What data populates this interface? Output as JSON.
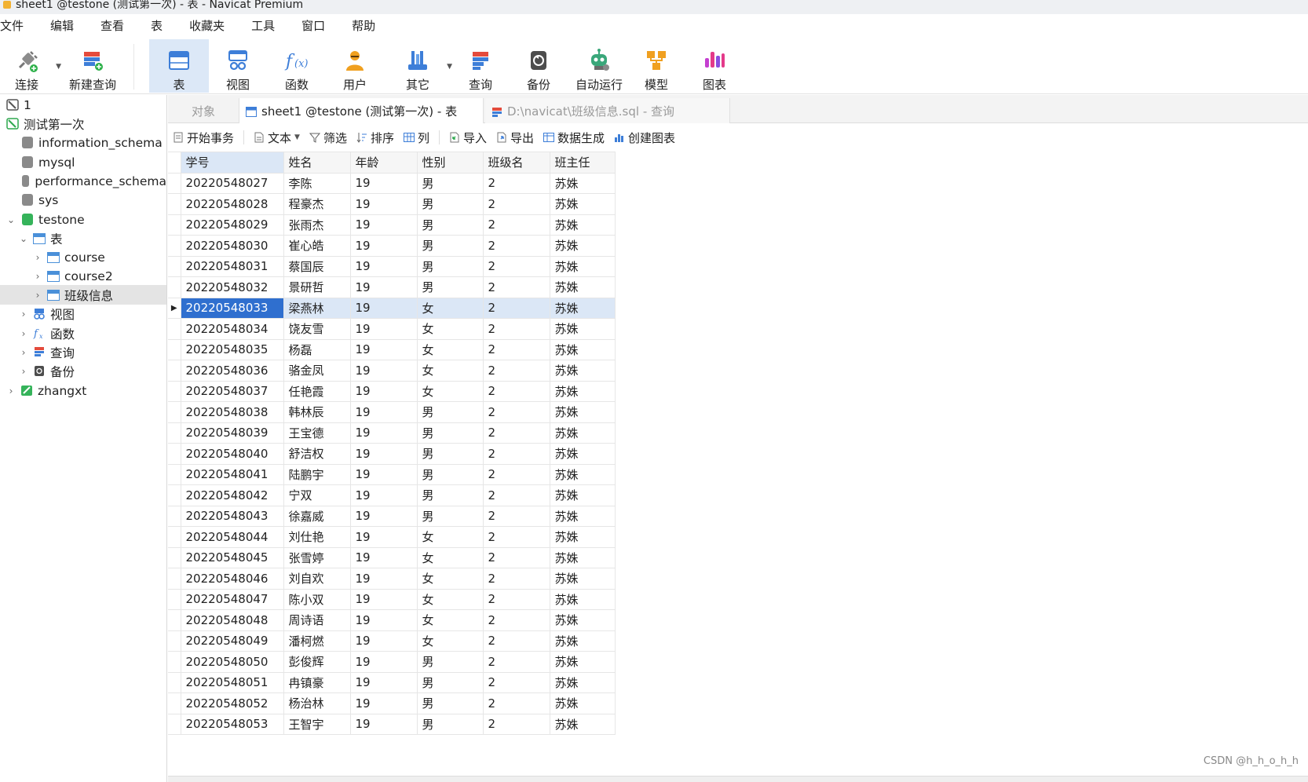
{
  "window": {
    "title": "sheet1 @testone (测试第一次) - 表 - Navicat Premium"
  },
  "menu": [
    "文件",
    "编辑",
    "查看",
    "表",
    "收藏夹",
    "工具",
    "窗口",
    "帮助"
  ],
  "toolbar": {
    "connect": "连接",
    "new_query": "新建查询",
    "table": "表",
    "view": "视图",
    "function": "函数",
    "user": "用户",
    "other": "其它",
    "query": "查询",
    "backup": "备份",
    "automation": "自动运行",
    "model": "模型",
    "chart": "图表"
  },
  "sidebar": {
    "items": [
      {
        "label": "1"
      },
      {
        "label": "测试第一次"
      },
      {
        "label": "information_schema"
      },
      {
        "label": "mysql"
      },
      {
        "label": "performance_schema"
      },
      {
        "label": "sys"
      },
      {
        "label": "testone"
      },
      {
        "label": "表"
      },
      {
        "label": "course"
      },
      {
        "label": "course2"
      },
      {
        "label": "班级信息"
      },
      {
        "label": "视图"
      },
      {
        "label": "函数"
      },
      {
        "label": "查询"
      },
      {
        "label": "备份"
      },
      {
        "label": "zhangxt"
      }
    ]
  },
  "tabs": {
    "objects": "对象",
    "active": "sheet1 @testone (测试第一次) - 表",
    "inactive": "D:\\navicat\\班级信息.sql - 查询"
  },
  "actions": {
    "begin_transaction": "开始事务",
    "text": "文本",
    "filter": "筛选",
    "sort": "排序",
    "columns": "列",
    "import": "导入",
    "export": "导出",
    "data_generation": "数据生成",
    "create_chart": "创建图表"
  },
  "grid": {
    "columns": [
      "学号",
      "姓名",
      "年龄",
      "性别",
      "班级名",
      "班主任"
    ],
    "selected_row": 6,
    "rows": [
      [
        "20220548027",
        "李陈",
        "19",
        "男",
        "2",
        "苏姝"
      ],
      [
        "20220548028",
        "程豪杰",
        "19",
        "男",
        "2",
        "苏姝"
      ],
      [
        "20220548029",
        "张雨杰",
        "19",
        "男",
        "2",
        "苏姝"
      ],
      [
        "20220548030",
        "崔心皓",
        "19",
        "男",
        "2",
        "苏姝"
      ],
      [
        "20220548031",
        "蔡国辰",
        "19",
        "男",
        "2",
        "苏姝"
      ],
      [
        "20220548032",
        "景研哲",
        "19",
        "男",
        "2",
        "苏姝"
      ],
      [
        "20220548033",
        "梁燕林",
        "19",
        "女",
        "2",
        "苏姝"
      ],
      [
        "20220548034",
        "饶友雪",
        "19",
        "女",
        "2",
        "苏姝"
      ],
      [
        "20220548035",
        "杨磊",
        "19",
        "女",
        "2",
        "苏姝"
      ],
      [
        "20220548036",
        "骆金凤",
        "19",
        "女",
        "2",
        "苏姝"
      ],
      [
        "20220548037",
        "任艳霞",
        "19",
        "女",
        "2",
        "苏姝"
      ],
      [
        "20220548038",
        "韩林辰",
        "19",
        "男",
        "2",
        "苏姝"
      ],
      [
        "20220548039",
        "王宝德",
        "19",
        "男",
        "2",
        "苏姝"
      ],
      [
        "20220548040",
        "舒洁权",
        "19",
        "男",
        "2",
        "苏姝"
      ],
      [
        "20220548041",
        "陆鹏宇",
        "19",
        "男",
        "2",
        "苏姝"
      ],
      [
        "20220548042",
        "宁双",
        "19",
        "男",
        "2",
        "苏姝"
      ],
      [
        "20220548043",
        "徐嘉威",
        "19",
        "男",
        "2",
        "苏姝"
      ],
      [
        "20220548044",
        "刘仕艳",
        "19",
        "女",
        "2",
        "苏姝"
      ],
      [
        "20220548045",
        "张雪婷",
        "19",
        "女",
        "2",
        "苏姝"
      ],
      [
        "20220548046",
        "刘自欢",
        "19",
        "女",
        "2",
        "苏姝"
      ],
      [
        "20220548047",
        "陈小双",
        "19",
        "女",
        "2",
        "苏姝"
      ],
      [
        "20220548048",
        "周诗语",
        "19",
        "女",
        "2",
        "苏姝"
      ],
      [
        "20220548049",
        "潘柯燃",
        "19",
        "女",
        "2",
        "苏姝"
      ],
      [
        "20220548050",
        "彭俊辉",
        "19",
        "男",
        "2",
        "苏姝"
      ],
      [
        "20220548051",
        "冉镇豪",
        "19",
        "男",
        "2",
        "苏姝"
      ],
      [
        "20220548052",
        "杨治林",
        "19",
        "男",
        "2",
        "苏姝"
      ],
      [
        "20220548053",
        "王智宇",
        "19",
        "男",
        "2",
        "苏姝"
      ]
    ]
  },
  "watermark": "CSDN @h_h_o_h_h",
  "colors": {
    "accent": "#2f6fcf",
    "selection": "#dbe7f6"
  }
}
